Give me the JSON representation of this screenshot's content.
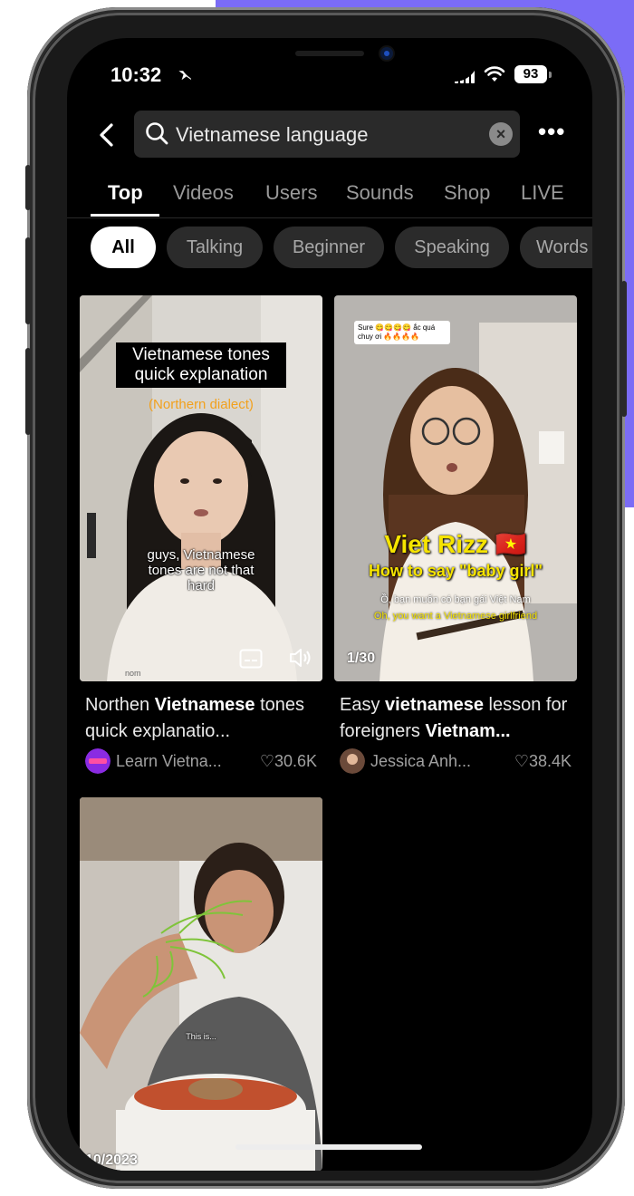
{
  "status": {
    "time": "10:32",
    "battery": "93"
  },
  "search": {
    "query": "Vietnamese language"
  },
  "tabs": [
    {
      "label": "Top",
      "active": true
    },
    {
      "label": "Videos"
    },
    {
      "label": "Users"
    },
    {
      "label": "Sounds"
    },
    {
      "label": "Shop"
    },
    {
      "label": "LIVE"
    }
  ],
  "chips": [
    {
      "label": "All",
      "active": true
    },
    {
      "label": "Talking"
    },
    {
      "label": "Beginner"
    },
    {
      "label": "Speaking"
    },
    {
      "label": "Words"
    }
  ],
  "results": [
    {
      "overlay_title": "Vietnamese tones quick explanation",
      "overlay_yellow": "(Northern dialect)",
      "overlay_sub": "guys, Vietnamese tones are not that hard",
      "caption_pre": "Northen ",
      "caption_bold": "Vietnamese",
      "caption_post": " tones quick explanatio...",
      "author": "Learn Vietna...",
      "likes": "30.6K"
    },
    {
      "overlay_comment": "Sure 😋😋😋😋 ắc quá chuy ơi 🔥🔥🔥🔥",
      "overlay_title": "Viet Rizz 🇻🇳",
      "overlay_sub1": "How to say \"baby girl\"",
      "overlay_vi": "Ồ, bạn muốn có bạn gái Việt Nam",
      "overlay_en": "Oh, you want a Vietnamese girlfriend",
      "counter": "1/30",
      "caption_pre": "Easy ",
      "caption_bold": "vietnamese",
      "caption_mid": " lesson for foreigners ",
      "caption_bold2": "Vietnam...",
      "author": "Jessica Anh...",
      "likes": "38.4K"
    },
    {
      "overlay_sub": "This is...",
      "date": "10/2023"
    }
  ],
  "colors": {
    "accent_bg": "#7b6cf6",
    "screen_bg": "#000000",
    "chip_bg": "#2b2b2b"
  }
}
